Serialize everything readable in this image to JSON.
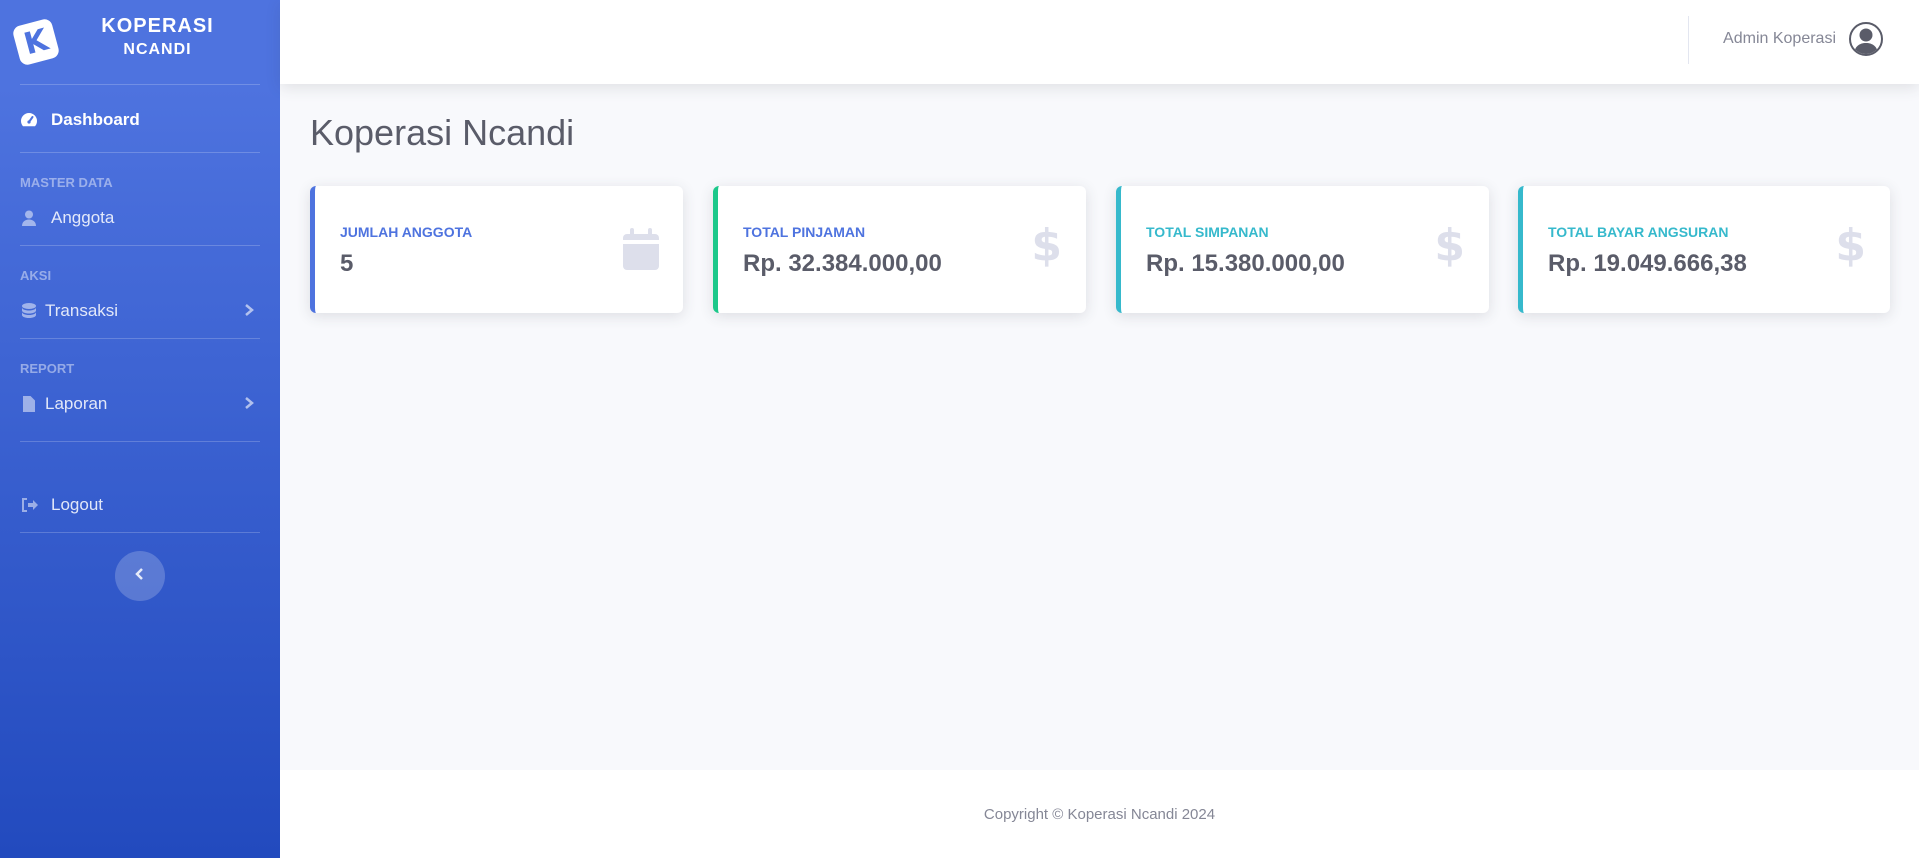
{
  "sidebar": {
    "brand": {
      "logo_letter": "K",
      "line1": "KOPERASI",
      "line2": "NCANDI"
    },
    "dashboard": {
      "label": "Dashboard",
      "icon": "tachometer-icon"
    },
    "headings": {
      "master": "MASTER DATA",
      "aksi": "AKSI",
      "report": "REPORT"
    },
    "anggota": {
      "label": "Anggota",
      "icon": "user-icon"
    },
    "transaksi": {
      "label": "Transaksi",
      "icon": "database-icon"
    },
    "laporan": {
      "label": "Laporan",
      "icon": "file-icon"
    },
    "logout": {
      "label": "Logout",
      "icon": "sign-out-icon"
    }
  },
  "topbar": {
    "user_name": "Admin Koperasi"
  },
  "main": {
    "title": "Koperasi Ncandi",
    "cards": [
      {
        "label": "JUMLAH ANGGOTA",
        "value": "5",
        "color": "#4e73df",
        "icon": "calendar-icon"
      },
      {
        "label": "TOTAL PINJAMAN",
        "value": "Rp. 32.384.000,00",
        "color": "#1cc88a",
        "icon": "dollar-icon"
      },
      {
        "label": "TOTAL SIMPANAN",
        "value": "Rp. 15.380.000,00",
        "color": "#36b9cc",
        "icon": "dollar-icon"
      },
      {
        "label": "TOTAL BAYAR ANGSURAN",
        "value": "Rp. 19.049.666,38",
        "color": "#36b9cc",
        "icon": "dollar-icon"
      }
    ]
  },
  "footer": {
    "text": "Copyright © Koperasi Ncandi 2024"
  },
  "colors": {
    "primary": "#4e73df",
    "success": "#1cc88a",
    "info": "#36b9cc"
  }
}
